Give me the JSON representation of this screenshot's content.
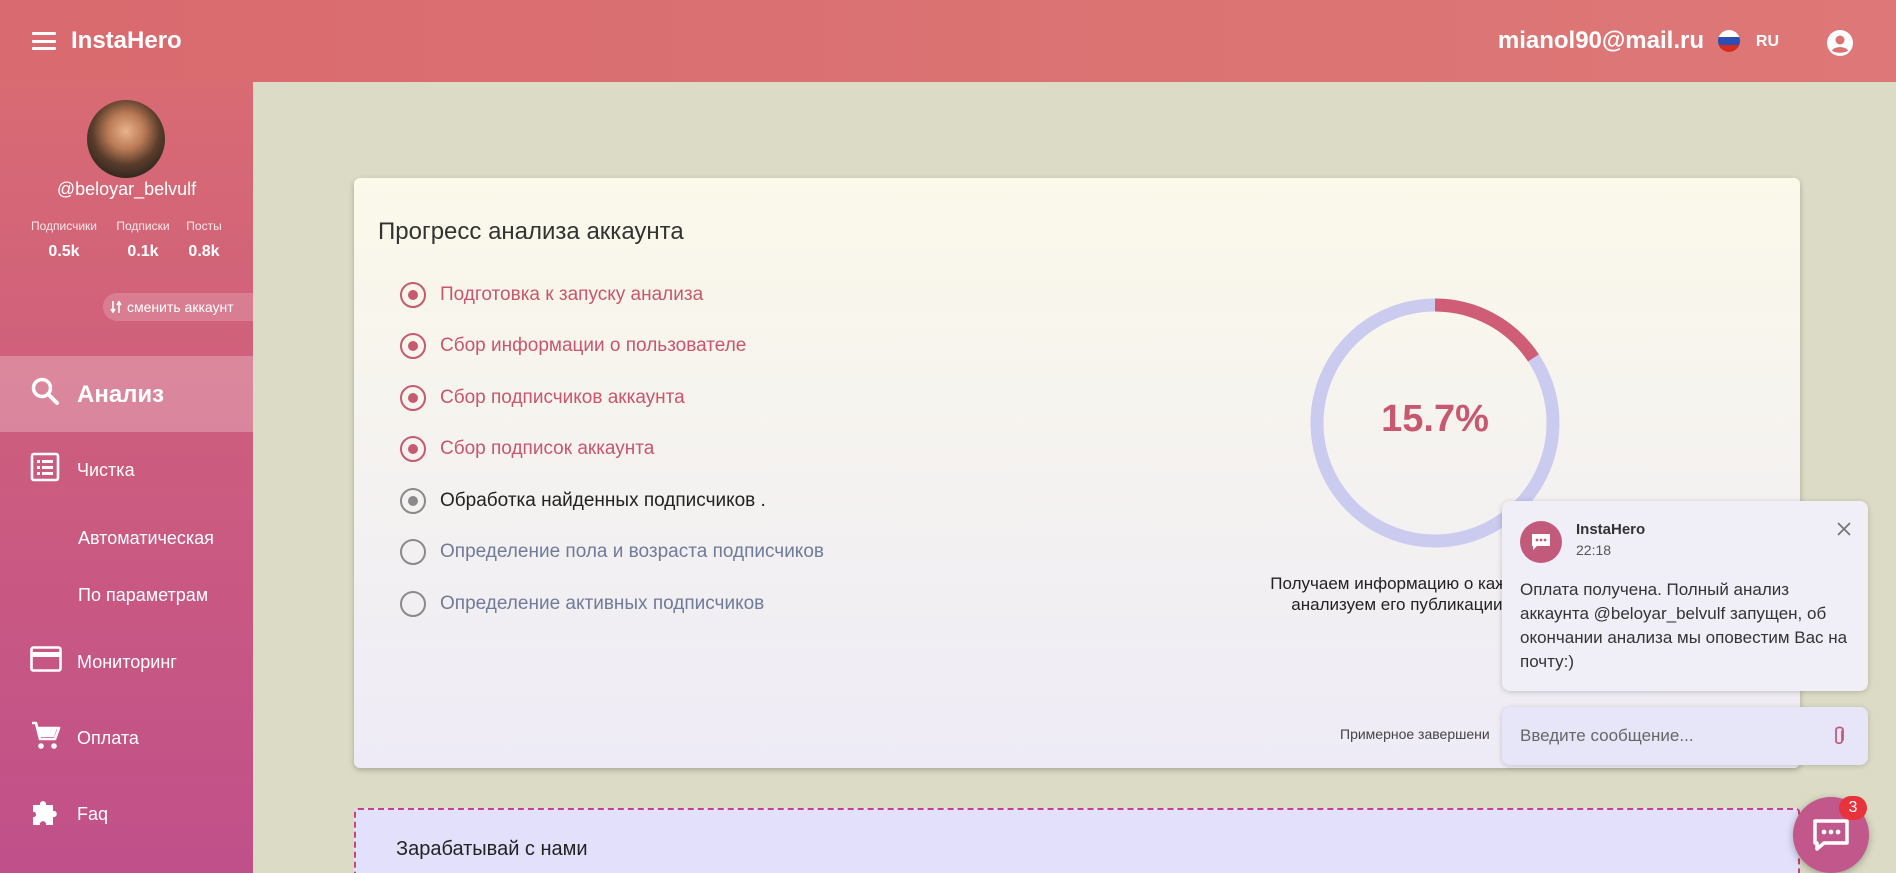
{
  "header": {
    "brand": "InstaHero",
    "email": "mianol90@mail.ru",
    "lang": "RU"
  },
  "profile": {
    "username": "@beloyar_belvulf",
    "stats": [
      {
        "label": "Подписчики",
        "value": "0.5k"
      },
      {
        "label": "Подписки",
        "value": "0.1k"
      },
      {
        "label": "Посты",
        "value": "0.8k"
      }
    ],
    "switch_label": "сменить аккаунт"
  },
  "nav": {
    "analysis": "Анализ",
    "cleanup": "Чистка",
    "auto": "Автоматическая",
    "by_params": "По параметрам",
    "monitoring": "Мониторинг",
    "payment": "Оплата",
    "faq": "Faq"
  },
  "progress": {
    "title": "Прогресс анализа аккаунта",
    "steps": [
      {
        "label": "Подготовка к запуску анализа",
        "state": "done"
      },
      {
        "label": "Сбор информации о пользователе",
        "state": "done"
      },
      {
        "label": "Сбор подписчиков аккаунта",
        "state": "done"
      },
      {
        "label": "Сбор подписок аккаунта",
        "state": "done"
      },
      {
        "label": "Обработка найденных подписчиков .",
        "state": "current"
      },
      {
        "label": "Определение пола и возраста подписчиков",
        "state": "pending"
      },
      {
        "label": "Определение активных подписчиков",
        "state": "pending"
      }
    ],
    "percent_label": "15.7%",
    "percent_value": 15.7,
    "info_line1": "Получаем информацию о каждом",
    "info_line2": "анализуем его публикации и",
    "eta": "Примерное завершени"
  },
  "earn": {
    "title": "Зарабатывай с нами"
  },
  "chat": {
    "name": "InstaHero",
    "time": "22:18",
    "message": "Оплата получена. Полный анализ аккаунта @beloyar_belvulf запущен, об окончании анализа мы оповестим Вас на почту:)",
    "placeholder": "Введите сообщение...",
    "badge": "3"
  },
  "colors": {
    "accent": "#c8566c",
    "ring_track": "#c9c9f0",
    "fab": "#c1578a",
    "badge": "#e8323c"
  }
}
